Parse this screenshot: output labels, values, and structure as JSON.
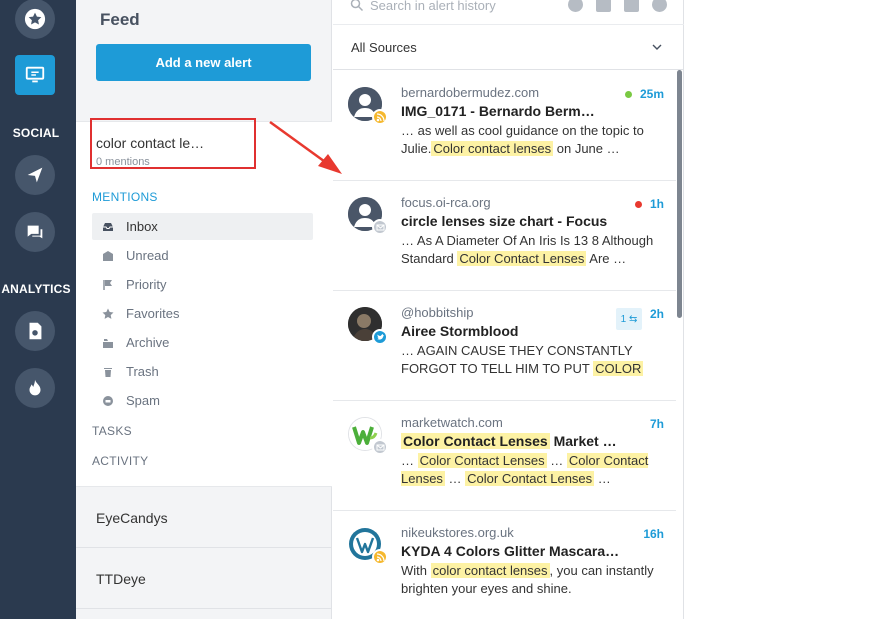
{
  "rail": {
    "social_label": "SOCIAL",
    "analytics_label": "ANALYTICS",
    "accent": "#1e9bd7",
    "background": "#2b3a4f"
  },
  "feed": {
    "title": "Feed",
    "add_button": "Add a new alert",
    "active_alert": {
      "name": "color contact le…",
      "count": "0 mentions"
    },
    "mentions_label": "MENTIONS",
    "menu": [
      {
        "label": "Inbox",
        "icon": "inbox-icon"
      },
      {
        "label": "Unread",
        "icon": "unread-icon"
      },
      {
        "label": "Priority",
        "icon": "flag-icon"
      },
      {
        "label": "Favorites",
        "icon": "star-icon"
      },
      {
        "label": "Archive",
        "icon": "archive-icon"
      },
      {
        "label": "Trash",
        "icon": "trash-icon"
      },
      {
        "label": "Spam",
        "icon": "spam-icon"
      }
    ],
    "tasks_label": "TASKS",
    "activity_label": "ACTIVITY",
    "other_alerts": [
      "EyeCandys",
      "TTDeye"
    ]
  },
  "results": {
    "search_placeholder": "Search in alert history",
    "source_filter": "All Sources",
    "items": [
      {
        "source": "bernardobermudez.com",
        "time": "25m",
        "status_color": "#7ac943",
        "badge": "rss",
        "title": "IMG_0171 - Bernardo Berm…",
        "snippet_pre": "… as well as cool guidance on the topic to Julie.",
        "snippet_hl": "Color contact lenses",
        "snippet_post": " on June …"
      },
      {
        "source": "focus.oi-rca.org",
        "time": "1h",
        "status_color": "#e8392f",
        "badge": "mail",
        "title": "circle lenses size chart - Focus",
        "snippet_pre": "… As A Diameter Of An Iris Is 13 8 Although Standard ",
        "snippet_hl": "Color Contact Lenses",
        "snippet_post": " Are …"
      },
      {
        "source": "@hobbitship",
        "time": "2h",
        "share_count": "1",
        "badge": "twitter",
        "title": "Airee Stormblood",
        "snippet_pre": "… AGAIN CAUSE THEY CONSTANTLY FORGOT TO TELL HIM TO PUT ",
        "snippet_hl": "COLOR",
        "snippet_post": ""
      },
      {
        "source": "marketwatch.com",
        "time": "7h",
        "badge": "mail",
        "title_hl": "Color Contact Lenses",
        "title_post": " Market …",
        "snippet_parts": [
          "… ",
          "Color Contact Lenses",
          " … ",
          "Color Contact Lenses",
          " … ",
          "Color Contact Lenses",
          " …"
        ]
      },
      {
        "source": "nikeukstores.org.uk",
        "time": "16h",
        "badge": "rss",
        "title": "KYDA 4 Colors Glitter Mascara…",
        "snippet_pre": "With ",
        "snippet_hl": "color contact lenses",
        "snippet_post": ", you can instantly brighten your eyes and shine."
      }
    ]
  }
}
